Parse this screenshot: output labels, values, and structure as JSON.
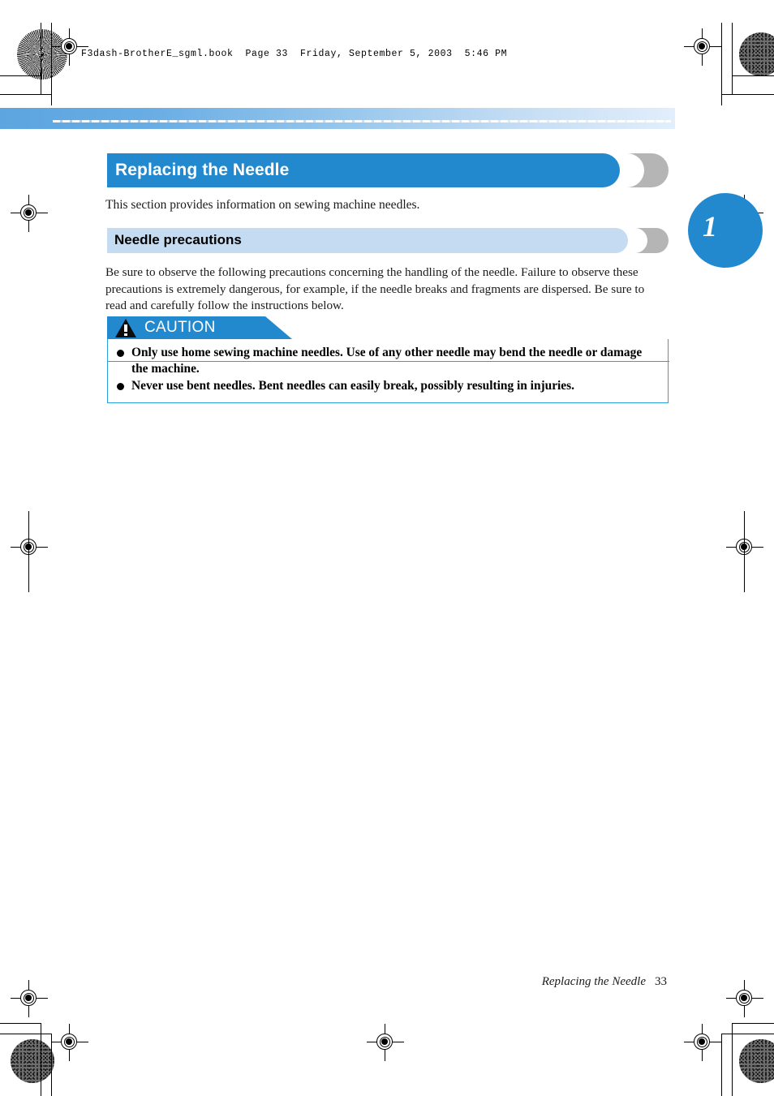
{
  "document": {
    "header_line": "F3dash-BrotherE_sgml.book  Page 33  Friday, September 5, 2003  5:46 PM",
    "page_number": "33",
    "chapter_number": "1"
  },
  "section": {
    "title": "Replacing the Needle",
    "intro": "This section provides information on sewing machine needles."
  },
  "subsection": {
    "title": "Needle precautions",
    "body": "Be sure to observe the following precautions concerning the handling of the needle. Failure to observe these precautions is extremely dangerous, for example, if the needle breaks and fragments are dispersed. Be sure to read and carefully follow the instructions below."
  },
  "caution": {
    "label": "CAUTION",
    "items": [
      "Only use home sewing machine needles. Use of any other needle may bend the needle or damage the machine.",
      "Never use bent needles. Bent needles can easily break, possibly resulting in injuries."
    ]
  },
  "footer": {
    "running_title": "Replacing the Needle",
    "page": "33"
  },
  "colors": {
    "accent_blue": "#2289cf",
    "light_blue": "#c5dbf2",
    "caution_border": "#29a3dd",
    "shadow_gray": "#b5b5b5"
  }
}
